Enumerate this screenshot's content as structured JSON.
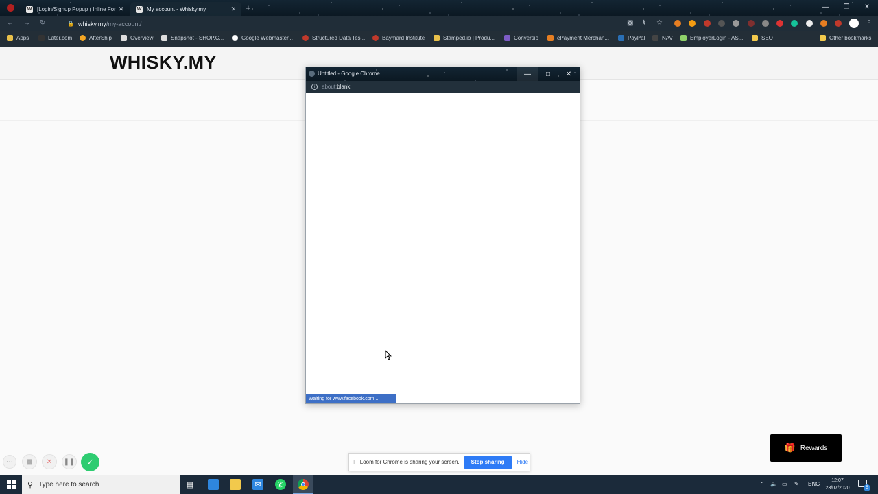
{
  "browser": {
    "tabs": [
      {
        "label": "[Login/Signup Popup ( Inline For",
        "favicon": "W",
        "active": false
      },
      {
        "label": "My account - Whisky.my",
        "favicon": "W",
        "active": true
      }
    ],
    "new_tab": "+",
    "address": {
      "host": "whisky.my",
      "path": "/my-account/"
    },
    "bookmarks": [
      {
        "label": "Apps",
        "icon": "apps-icon",
        "color": "#e8c04a"
      },
      {
        "label": "Later.com",
        "icon": "later-icon",
        "color": "#333"
      },
      {
        "label": "AfterShip",
        "icon": "aftership-icon",
        "color": "#f5a623"
      },
      {
        "label": "Overview",
        "icon": "overview-icon",
        "color": "#ddd"
      },
      {
        "label": "Snapshot - SHOP.C...",
        "icon": "snapshot-icon",
        "color": "#ddd"
      },
      {
        "label": "Google Webmaster...",
        "icon": "google-icon",
        "color": "#ffffff"
      },
      {
        "label": "Structured Data Tes...",
        "icon": "structured-data-icon",
        "color": "#c0392b"
      },
      {
        "label": "Baymard Institute",
        "icon": "baymard-icon",
        "color": "#c0392b"
      },
      {
        "label": "Stamped.io | Produ...",
        "icon": "stamped-icon",
        "color": "#e8c04a"
      },
      {
        "label": "Conversio",
        "icon": "conversio-icon",
        "color": "#7d5cc6"
      },
      {
        "label": "ePayment Merchan...",
        "icon": "epayment-icon",
        "color": "#e67e22"
      },
      {
        "label": "PayPal",
        "icon": "paypal-icon",
        "color": "#2a6fb5"
      },
      {
        "label": "NAV",
        "icon": "nav-icon",
        "color": "#444"
      },
      {
        "label": "EmployerLogin - AS...",
        "icon": "employer-icon",
        "color": "#8fd16a"
      },
      {
        "label": "SEO",
        "icon": "folder-icon",
        "color": "#f2c94c"
      },
      {
        "label": "Other bookmarks",
        "icon": "folder-icon",
        "color": "#f2c94c"
      }
    ]
  },
  "site": {
    "logo": "WHISKY.MY"
  },
  "popup": {
    "title": "Untitled - Google Chrome",
    "address_scheme": "about:",
    "address_rest": "blank",
    "status": "Waiting for www.facebook.com..."
  },
  "rewards": {
    "label": "Rewards"
  },
  "loom": {
    "message": "Loom for Chrome is sharing your screen.",
    "stop_label": "Stop sharing",
    "hide_label": "Hide"
  },
  "taskbar": {
    "search_placeholder": "Type here to search",
    "language": "ENG",
    "time": "12:07",
    "date": "23/07/2020",
    "notification_count": "5"
  },
  "colors": {
    "accent": "#2e7bf6",
    "status_bar": "#3d6fc6",
    "loom_confirm": "#2ecc71",
    "loom_cancel": "#e57373"
  }
}
